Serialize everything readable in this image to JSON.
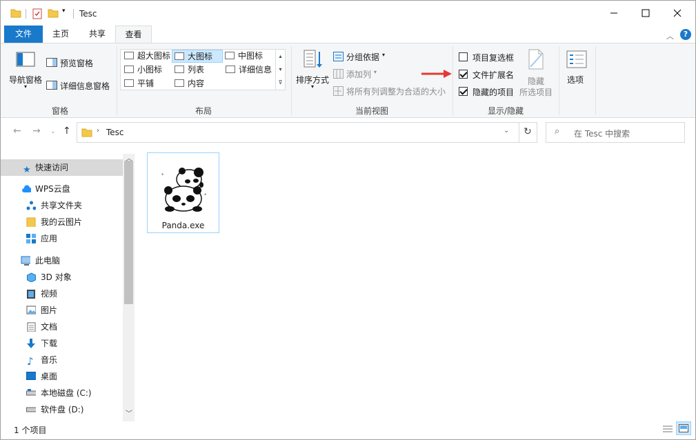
{
  "title": "Tesc",
  "tabs": {
    "file": "文件",
    "home": "主页",
    "share": "共享",
    "view": "查看"
  },
  "ribbon": {
    "panes": {
      "nav_pane": "导航窗格",
      "preview_pane": "预览窗格",
      "details_pane": "详细信息窗格",
      "group": "窗格"
    },
    "layout": {
      "xl_icons": "超大图标",
      "large_icons": "大图标",
      "medium_icons": "中图标",
      "small_icons": "小图标",
      "list": "列表",
      "details": "详细信息",
      "tiles": "平铺",
      "content": "内容",
      "group": "布局"
    },
    "current_view": {
      "sort_by": "排序方式",
      "group_by": "分组依据",
      "add_columns": "添加列",
      "size_all_columns": "将所有列调整为合适的大小",
      "group": "当前视图"
    },
    "show_hide": {
      "item_checkboxes": "项目复选框",
      "item_checkboxes_checked": false,
      "file_extensions": "文件扩展名",
      "file_extensions_checked": true,
      "hidden_items": "隐藏的项目",
      "hidden_items_checked": true,
      "hide_selected_1": "隐藏",
      "hide_selected_2": "所选项目",
      "group": "显示/隐藏"
    },
    "options": "选项"
  },
  "address": {
    "path": "Tesc",
    "search_placeholder": "在 Tesc 中搜索"
  },
  "sidebar": {
    "quick_access": "快速访问",
    "wps_cloud": "WPS云盘",
    "shared_folder": "共享文件夹",
    "my_cloud_pics": "我的云图片",
    "apps": "应用",
    "this_pc": "此电脑",
    "objects_3d": "3D 对象",
    "videos": "视频",
    "pictures": "图片",
    "documents": "文档",
    "downloads": "下载",
    "music": "音乐",
    "desktop": "桌面",
    "local_disk": "本地磁盘 (C:)",
    "software_disk": "软件盘 (D:)"
  },
  "files": [
    {
      "name": "Panda.exe"
    }
  ],
  "status": {
    "count": "1 个项目"
  },
  "colors": {
    "accent": "#1979ca",
    "selection": "#cce8ff",
    "arrow": "#e53935"
  }
}
